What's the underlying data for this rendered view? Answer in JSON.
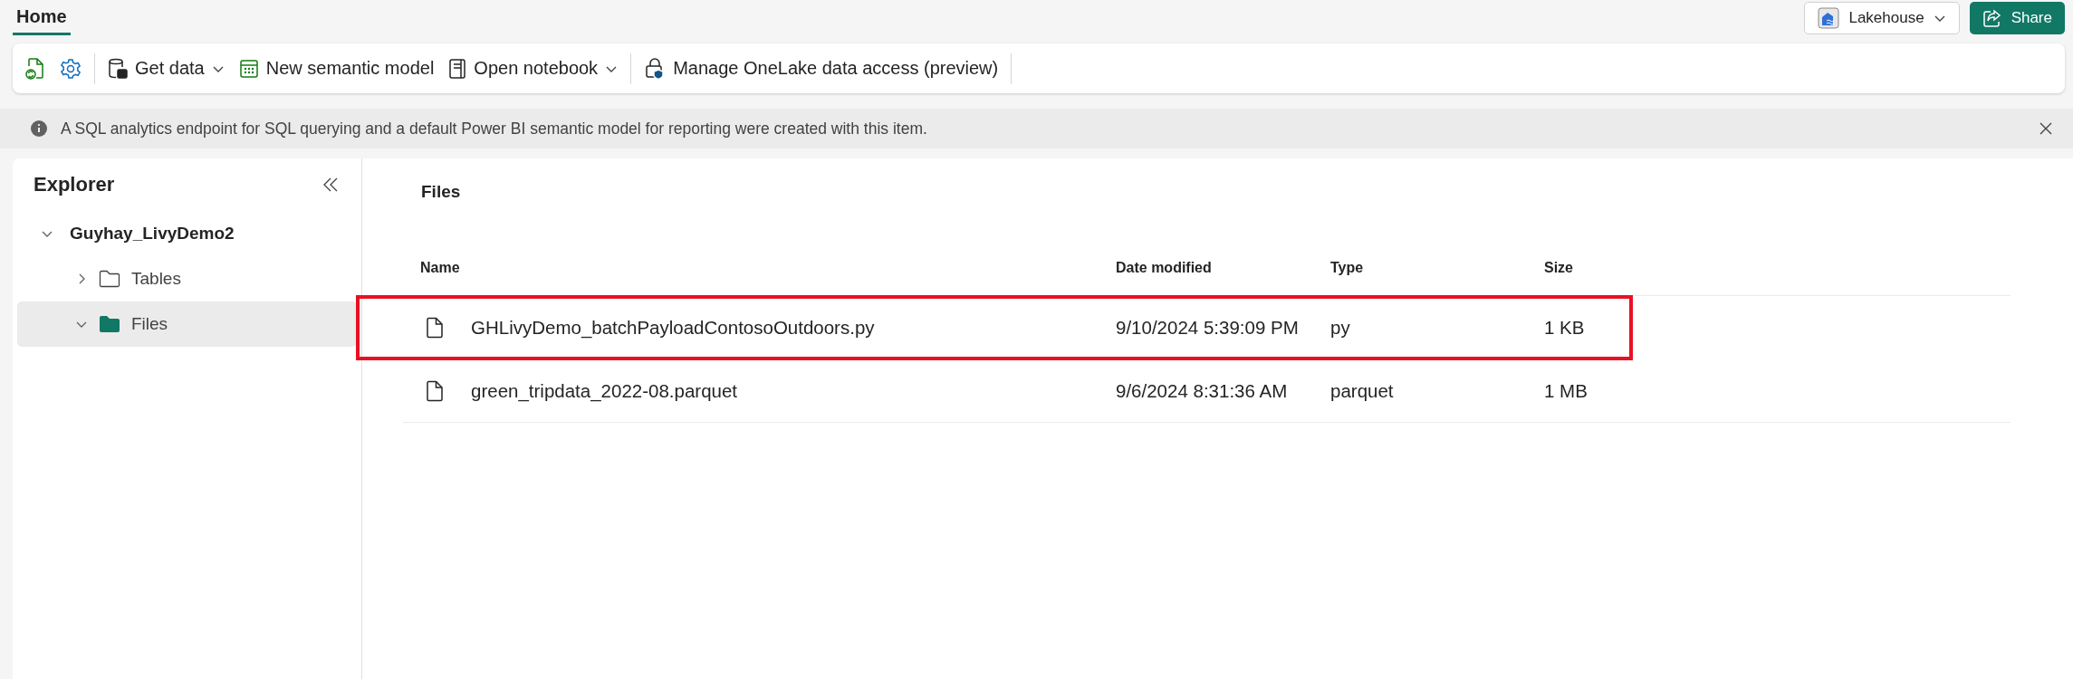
{
  "tabs": [
    {
      "label": "Home",
      "selected": true
    }
  ],
  "header_buttons": [
    {
      "label": "Lakehouse",
      "kind": "switcher"
    },
    {
      "label": "Share",
      "kind": "primary"
    }
  ],
  "toolbar": [
    {
      "label": "Get data",
      "has_menu": true
    },
    {
      "label": "New semantic model",
      "has_menu": false
    },
    {
      "label": "Open notebook",
      "has_menu": true
    },
    {
      "label": "Manage OneLake data access (preview)",
      "has_menu": false
    }
  ],
  "info_bar": {
    "text": "A SQL analytics endpoint for SQL querying and a default Power BI semantic model for reporting were created with this item.",
    "dismissible": true
  },
  "explorer": {
    "title": "Explorer",
    "tree": [
      {
        "label": "Guyhay_LivyDemo2",
        "expanded": true,
        "selected": false,
        "children": [
          {
            "label": "Tables",
            "expanded": false,
            "selected": false
          },
          {
            "label": "Files",
            "expanded": true,
            "selected": true
          }
        ]
      }
    ]
  },
  "files": {
    "title": "Files",
    "columns": [
      "Name",
      "Date modified",
      "Type",
      "Size"
    ],
    "rows": [
      {
        "cells": [
          "GHLivyDemo_batchPayloadContosoOutdoors.py",
          "9/10/2024 5:39:09 PM",
          "py",
          "1 KB"
        ],
        "highlighted": true
      },
      {
        "cells": [
          "green_tripdata_2022-08.parquet",
          "9/6/2024 8:31:36 AM",
          "parquet",
          "1 MB"
        ],
        "highlighted": false
      }
    ]
  }
}
